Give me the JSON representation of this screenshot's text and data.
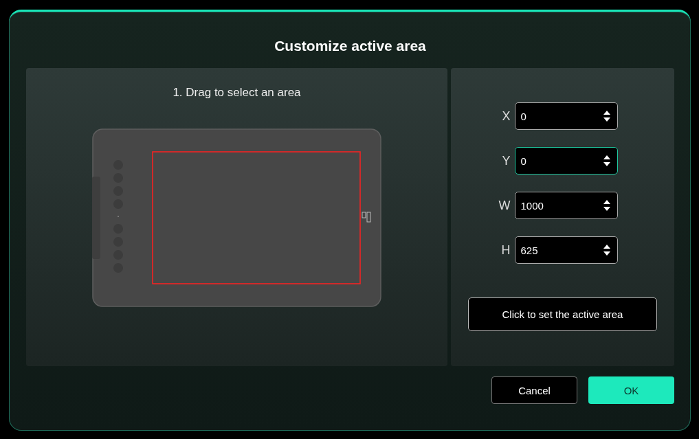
{
  "dialog": {
    "title": "Customize active area"
  },
  "preview": {
    "instruction": "1. Drag to select an area"
  },
  "fields": [
    {
      "label": "X",
      "value": "0",
      "selected": false
    },
    {
      "label": "Y",
      "value": "0",
      "selected": true
    },
    {
      "label": "W",
      "value": "1000",
      "selected": false
    },
    {
      "label": "H",
      "value": "625",
      "selected": false
    }
  ],
  "set_button": "Click to set the active area",
  "buttons": [
    {
      "label": "Cancel",
      "kind": "secondary"
    },
    {
      "label": "OK",
      "kind": "primary"
    }
  ]
}
